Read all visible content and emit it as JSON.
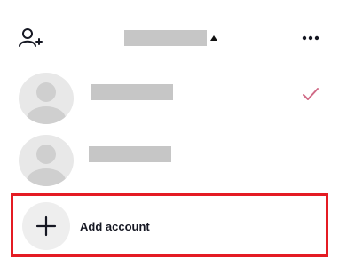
{
  "header": {
    "add_user_icon": "person-add-icon",
    "username_redacted": true,
    "switch_icon": "caret-up-icon",
    "more_icon": "more-horizontal-icon"
  },
  "accounts": [
    {
      "name_redacted": true,
      "avatar_icon": "default-avatar-icon",
      "selected": true
    },
    {
      "name_redacted": true,
      "avatar_icon": "default-avatar-icon",
      "selected": false
    }
  ],
  "add_account": {
    "label": "Add account",
    "icon": "plus-icon"
  },
  "colors": {
    "highlight_border": "#e41b23",
    "check": "#d06a86",
    "placeholder": "#c6c6c6"
  }
}
